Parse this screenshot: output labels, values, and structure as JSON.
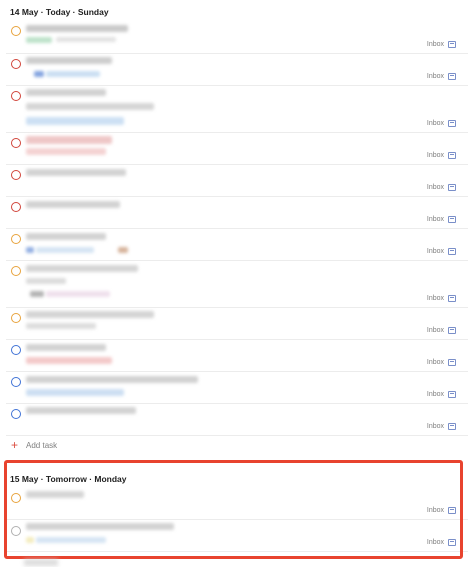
{
  "sections": [
    {
      "header": "14 May · Today · Sunday",
      "tasks": [
        {
          "priority_color": "#e8a33d",
          "project": "Inbox"
        },
        {
          "priority_color": "#d1453b",
          "project": "Inbox"
        },
        {
          "priority_color": "#d1453b",
          "project": "Inbox"
        },
        {
          "priority_color": "#d1453b",
          "project": "Inbox"
        },
        {
          "priority_color": "#d1453b",
          "project": "Inbox"
        },
        {
          "priority_color": "#d1453b",
          "project": "Inbox"
        },
        {
          "priority_color": "#e8a33d",
          "project": "Inbox"
        },
        {
          "priority_color": "#e8a33d",
          "project": "Inbox"
        },
        {
          "priority_color": "#e8a33d",
          "project": "Inbox"
        },
        {
          "priority_color": "#4073d6",
          "project": "Inbox"
        },
        {
          "priority_color": "#4073d6",
          "project": "Inbox"
        },
        {
          "priority_color": "#4073d6",
          "project": "Inbox"
        }
      ],
      "add_task_label": "Add task"
    },
    {
      "header": "15 May · Tomorrow · Monday",
      "tasks": [
        {
          "priority_color": "#e8a33d",
          "project": "Inbox"
        },
        {
          "priority_color": "#b0b0b0",
          "project": "Inbox"
        }
      ]
    }
  ],
  "colors": {
    "accent_red": "#db4c3f",
    "highlight_border": "#e8432e",
    "inbox_icon": "#7a8fc9"
  }
}
